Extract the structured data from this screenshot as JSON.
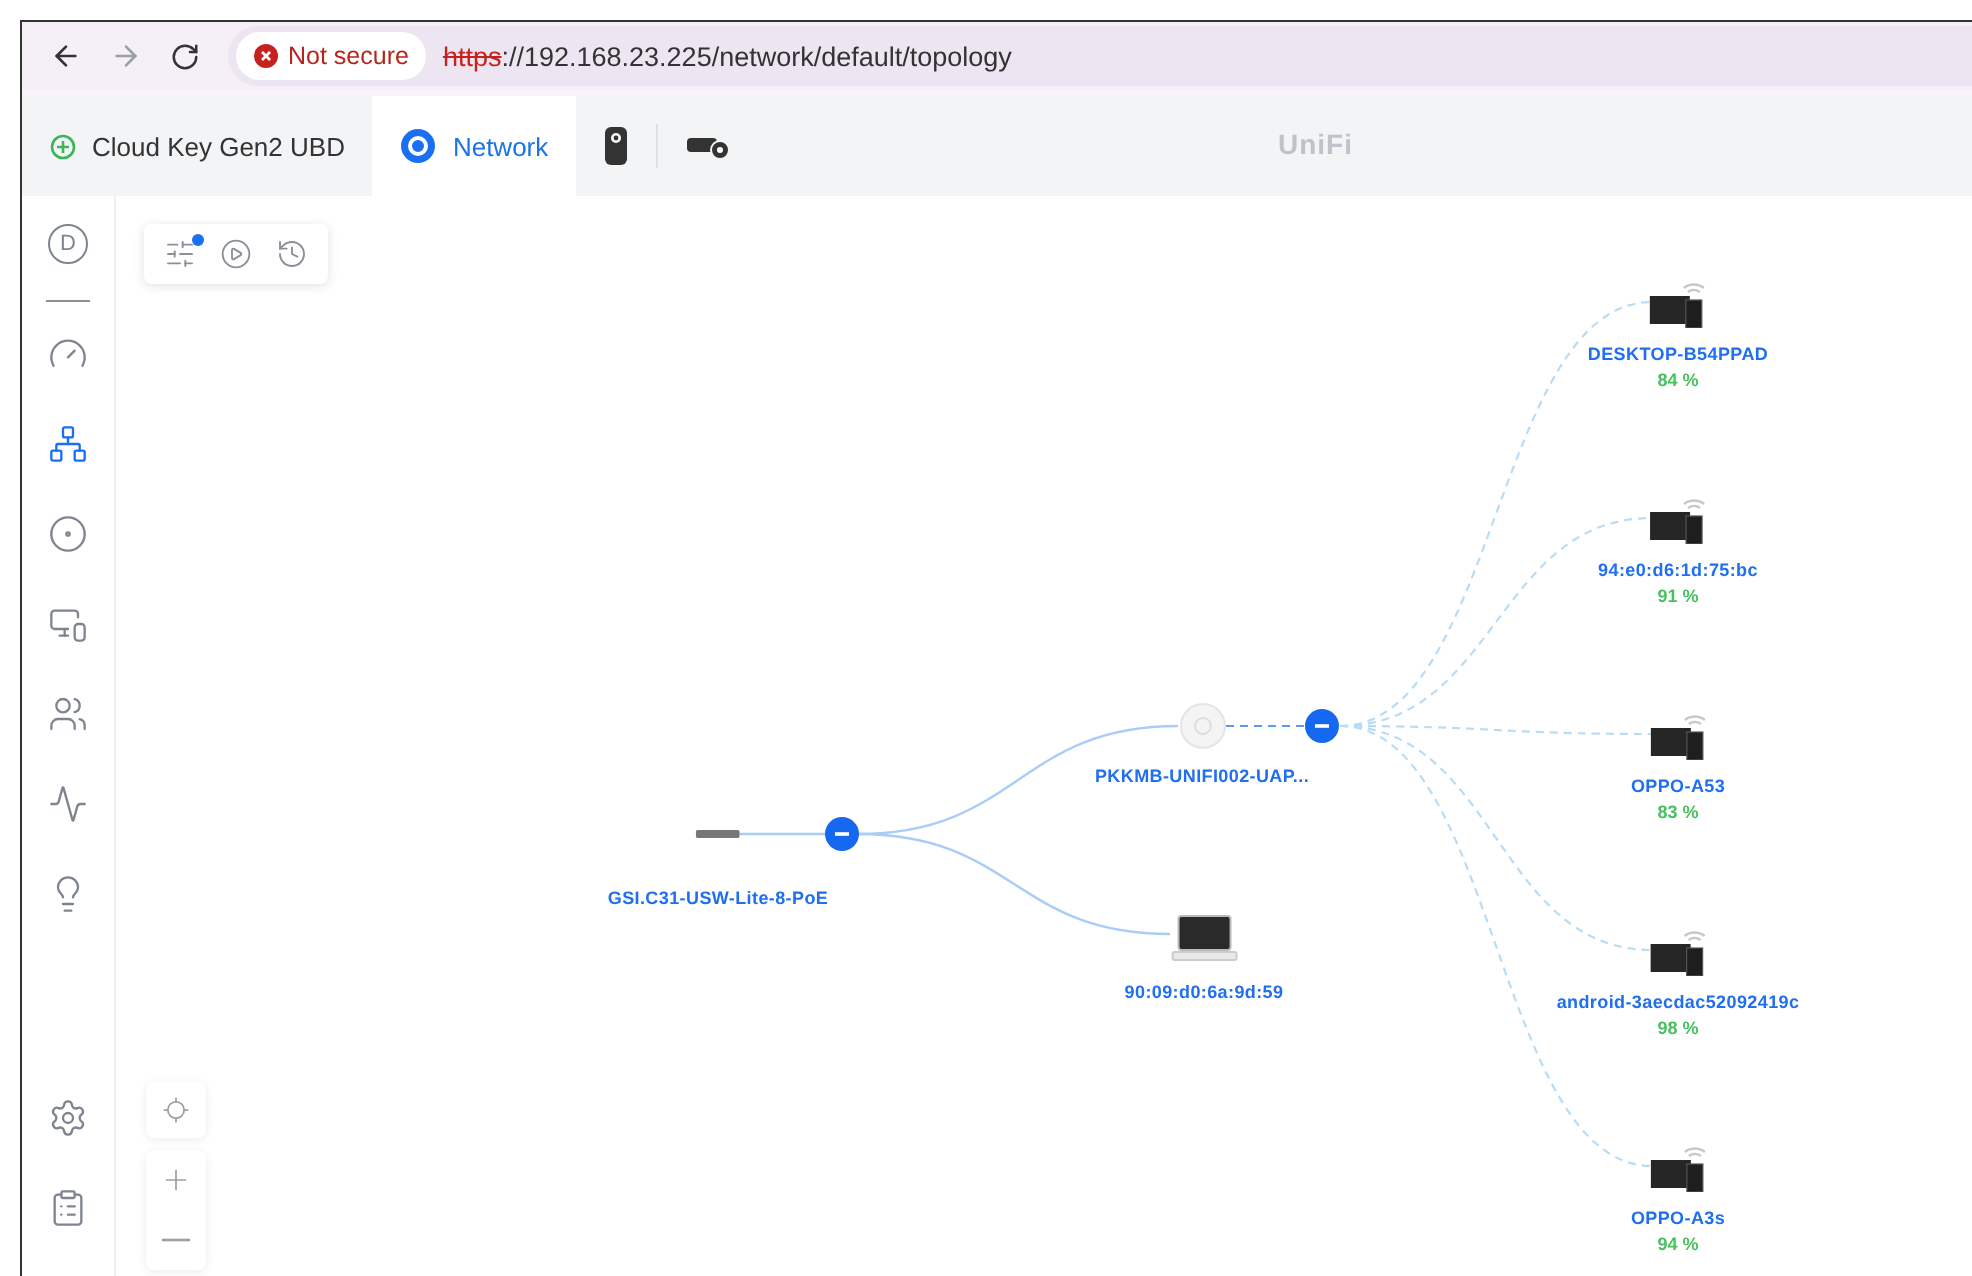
{
  "browser": {
    "security": "Not secure",
    "url_scheme": "https",
    "url_rest": "://192.168.23.225/network/default/topology"
  },
  "app_tabs": [
    {
      "kind": "console",
      "label": "Cloud Key Gen2 UBD",
      "selected": false
    },
    {
      "kind": "network",
      "label": "Network",
      "selected": true
    },
    {
      "kind": "protect",
      "selected": false
    },
    {
      "kind": "access",
      "selected": false
    }
  ],
  "brand": "UniFi",
  "sidebar": {
    "avatar": "D",
    "items": [
      {
        "kind": "dashboard",
        "selected": false
      },
      {
        "kind": "topology",
        "selected": true
      },
      {
        "kind": "ports",
        "selected": false
      },
      {
        "kind": "devices",
        "selected": false
      },
      {
        "kind": "clients",
        "selected": false
      },
      {
        "kind": "insights",
        "selected": false
      },
      {
        "kind": "hotspot",
        "selected": false
      }
    ],
    "bottom_items": [
      {
        "kind": "settings"
      },
      {
        "kind": "logs"
      }
    ]
  },
  "toolbar": {
    "filter_active": true
  },
  "topology": {
    "nodes": [
      {
        "kind": "switch",
        "name": "GSI.C31-USW-Lite-8-PoE",
        "expanded": true
      },
      {
        "kind": "ap",
        "name": "PKKMB-UNIFI002-UAP...",
        "expanded": true
      },
      {
        "kind": "laptop",
        "name": "90:09:d0:6a:9d:59"
      },
      {
        "kind": "wireless",
        "name": "DESKTOP-B54PPAD",
        "signal": "84 %"
      },
      {
        "kind": "wireless",
        "name": "94:e0:d6:1d:75:bc",
        "signal": "91 %"
      },
      {
        "kind": "wireless",
        "name": "OPPO-A53",
        "signal": "83 %"
      },
      {
        "kind": "wireless",
        "name": "android-3aecdac52092419c",
        "signal": "98 %"
      },
      {
        "kind": "wireless",
        "name": "OPPO-A3s",
        "signal": "94 %"
      }
    ]
  }
}
